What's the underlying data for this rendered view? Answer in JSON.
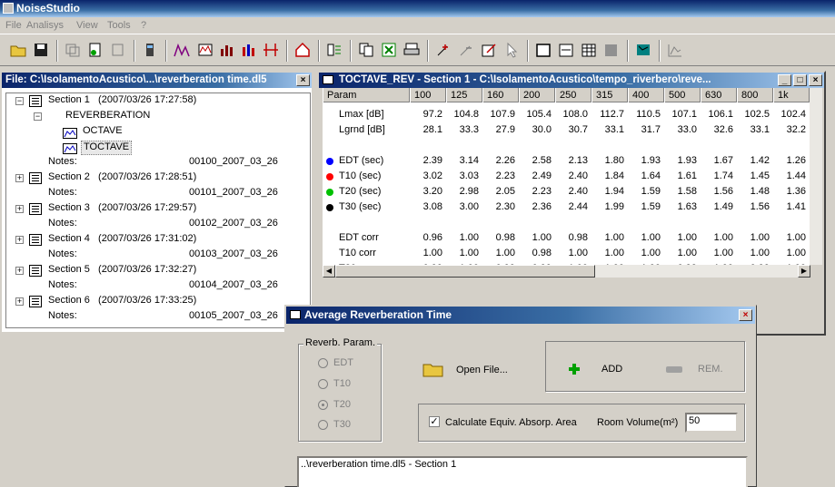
{
  "app": {
    "title": "NoiseStudio"
  },
  "menu": [
    "File",
    "Analisys",
    "View",
    "Tools",
    "?"
  ],
  "file_panel": {
    "title": "File: C:\\IsolamentoAcustico\\...\\reverberation time.dl5",
    "close": "×",
    "tree": [
      {
        "label": "Section 1",
        "date": "(2007/03/26 17:27:58)"
      },
      {
        "label": "REVERBERATION"
      },
      {
        "label": "OCTAVE"
      },
      {
        "label": "TOCTAVE"
      },
      {
        "label": "Notes:",
        "value": "00100_2007_03_26"
      },
      {
        "label": "Section 2",
        "date": "(2007/03/26 17:28:51)"
      },
      {
        "label": "Notes:",
        "value": "00101_2007_03_26"
      },
      {
        "label": "Section 3",
        "date": "(2007/03/26 17:29:57)"
      },
      {
        "label": "Notes:",
        "value": "00102_2007_03_26"
      },
      {
        "label": "Section 4",
        "date": "(2007/03/26 17:31:02)"
      },
      {
        "label": "Notes:",
        "value": "00103_2007_03_26"
      },
      {
        "label": "Section 5",
        "date": "(2007/03/26 17:32:27)"
      },
      {
        "label": "Notes:",
        "value": "00104_2007_03_26"
      },
      {
        "label": "Section 6",
        "date": "(2007/03/26 17:33:25)"
      },
      {
        "label": "Notes:",
        "value": "00105_2007_03_26"
      }
    ]
  },
  "data_window": {
    "title": "TOCTAVE_REV  - Section 1  - C:\\IsolamentoAcustico\\tempo_riverbero\\reve...",
    "min": "_",
    "max": "□",
    "close": "×",
    "header": [
      "Param",
      "100",
      "125",
      "160",
      "200",
      "250",
      "315",
      "400",
      "500",
      "630",
      "800",
      "1k"
    ],
    "rows": [
      {
        "label": "Lmax [dB]",
        "values": [
          "97.2",
          "104.8",
          "107.9",
          "105.4",
          "108.0",
          "112.7",
          "110.5",
          "107.1",
          "106.1",
          "102.5",
          "102.4"
        ]
      },
      {
        "label": "Lgrnd [dB]",
        "values": [
          "28.1",
          "33.3",
          "27.9",
          "30.0",
          "30.7",
          "33.1",
          "31.7",
          "33.0",
          "32.6",
          "33.1",
          "32.2"
        ]
      },
      {
        "label": "EDT (sec)",
        "dot": "#0000ff",
        "values": [
          "2.39",
          "3.14",
          "2.26",
          "2.58",
          "2.13",
          "1.80",
          "1.93",
          "1.93",
          "1.67",
          "1.42",
          "1.26"
        ]
      },
      {
        "label": "T10 (sec)",
        "dot": "#ff0000",
        "values": [
          "3.02",
          "3.03",
          "2.23",
          "2.49",
          "2.40",
          "1.84",
          "1.64",
          "1.61",
          "1.74",
          "1.45",
          "1.44"
        ]
      },
      {
        "label": "T20 (sec)",
        "dot": "#00c000",
        "values": [
          "3.20",
          "2.98",
          "2.05",
          "2.23",
          "2.40",
          "1.94",
          "1.59",
          "1.58",
          "1.56",
          "1.48",
          "1.36"
        ]
      },
      {
        "label": "T30 (sec)",
        "dot": "#000000",
        "values": [
          "3.08",
          "3.00",
          "2.30",
          "2.36",
          "2.44",
          "1.99",
          "1.59",
          "1.63",
          "1.49",
          "1.56",
          "1.41"
        ]
      },
      {
        "label": "EDT corr",
        "values": [
          "0.96",
          "1.00",
          "0.98",
          "1.00",
          "0.98",
          "1.00",
          "1.00",
          "1.00",
          "1.00",
          "1.00",
          "1.00"
        ]
      },
      {
        "label": "T10 corr",
        "values": [
          "1.00",
          "1.00",
          "1.00",
          "0.98",
          "1.00",
          "1.00",
          "1.00",
          "1.00",
          "1.00",
          "1.00",
          "1.00"
        ]
      },
      {
        "label": "T20 corr",
        "values": [
          "0.99",
          "1.00",
          "0.99",
          "0.99",
          "1.00",
          "1.00",
          "1.00",
          "0.99",
          "1.00",
          "0.99",
          "1.00"
        ]
      }
    ]
  },
  "dialog": {
    "title": "Average Reverberation Time",
    "close": "×",
    "group_label": "Reverb. Param.",
    "radios": [
      "EDT",
      "T10",
      "T20",
      "T30"
    ],
    "selected_radio": "T20",
    "open_file": "Open File...",
    "add": "ADD",
    "rem": "REM.",
    "calc_label": "Calculate Equiv. Absorp. Area",
    "calc_checked": true,
    "room_volume_label": "Room Volume(m²)",
    "room_volume_value": "50",
    "file_list": [
      "..\\reverberation time.dl5 - Section 1"
    ]
  }
}
